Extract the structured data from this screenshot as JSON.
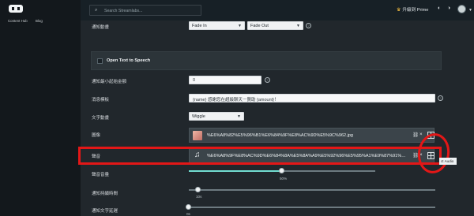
{
  "sidebar": {
    "links": [
      "Content Hub",
      "Blog"
    ]
  },
  "topbar": {
    "search_placeholder": "Search Streamlabs...",
    "prime_label": "升級到 Prime",
    "icons": [
      "search-icon",
      "crown-icon",
      "theme-icon",
      "user-avatar-icon",
      "dropdown-icon"
    ]
  },
  "alert_settings": {
    "animation_label": "通知動畫",
    "animation_in": "Fade In",
    "animation_out": "Fade Out",
    "tts_label": "Open Text to Speech",
    "min_amount_label": "通知最小起始金額",
    "min_amount_value": "0",
    "template_label": "消息模板",
    "template_value": "{name} 感謝您在超級聊天－贊助 {amount}！",
    "text_animation_label": "文字動畫",
    "text_animation_value": "Wiggle",
    "image_label": "圖像",
    "image_file": "%E6%A8%82%E5%96%B1%E6%84%9F%E8%AC%9D%E5%9C%962.jpg",
    "sound_label": "聲音",
    "sound_file": "%E6%A8%9F%E8%AC%9D%E6%84%8A%E5%8A%A9%E5%92%96%E5%95%A1%E9%87%91%E5%95%BE%E5...",
    "sound_volume_label": "聲音音量",
    "sound_volume_value": "50%",
    "alert_duration_label": "通知持續時間",
    "alert_duration_value": "10s",
    "text_delay_label": "通知文字延遲",
    "text_delay_value": "0s",
    "tooltip": "ct Audio"
  },
  "accent": "#72ddd1",
  "highlight_color": "#e31717",
  "volume_fraction": 0.5,
  "duration_fraction": 0.04,
  "text_delay_fraction": 0.0
}
